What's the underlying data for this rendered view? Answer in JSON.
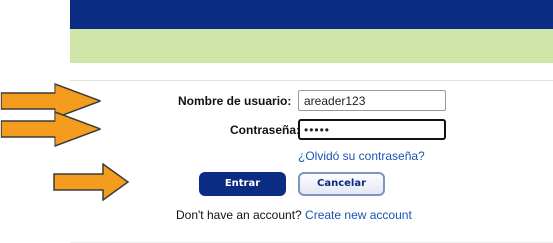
{
  "login": {
    "username_label": "Nombre de usuario:",
    "username_value": "areader123",
    "password_label": "Contraseña:",
    "password_value": "•••••",
    "forgot_link": "¿Olvidó su contraseña?",
    "enter_button": "Entrar",
    "cancel_button": "Cancelar"
  },
  "signup": {
    "prompt": "Don't have an account? ",
    "link": "Create new account"
  },
  "colors": {
    "header_bar": "#0a2c83",
    "subheader_bar": "#cfe5a7",
    "arrow_fill": "#f39c1d",
    "link": "#1a55b3"
  }
}
